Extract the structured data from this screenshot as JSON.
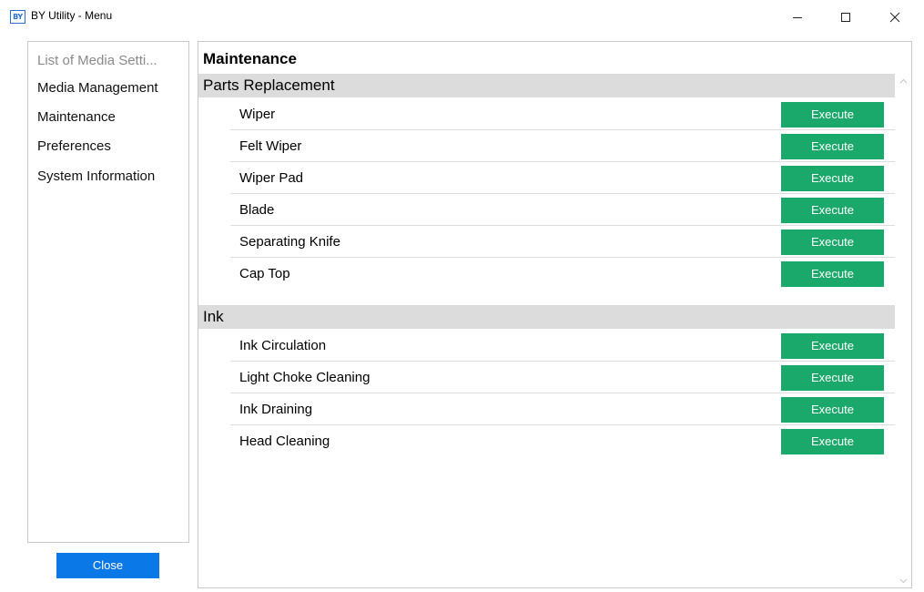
{
  "window": {
    "icon_text": "BY",
    "title": "BY Utility - Menu"
  },
  "sidebar": {
    "items": [
      {
        "label": "List of Media Setti..."
      },
      {
        "label": "Media Management"
      },
      {
        "label": "Maintenance"
      },
      {
        "label": "Preferences"
      },
      {
        "label": "System Information"
      }
    ],
    "close_label": "Close"
  },
  "main": {
    "title": "Maintenance",
    "sections": [
      {
        "title": "Parts Replacement",
        "rows": [
          {
            "label": "Wiper",
            "button": "Execute"
          },
          {
            "label": "Felt Wiper",
            "button": "Execute"
          },
          {
            "label": "Wiper Pad",
            "button": "Execute"
          },
          {
            "label": "Blade",
            "button": "Execute"
          },
          {
            "label": "Separating Knife",
            "button": "Execute"
          },
          {
            "label": "Cap Top",
            "button": "Execute"
          }
        ]
      },
      {
        "title": "Ink",
        "rows": [
          {
            "label": "Ink Circulation",
            "button": "Execute"
          },
          {
            "label": "Light Choke Cleaning",
            "button": "Execute"
          },
          {
            "label": "Ink Draining",
            "button": "Execute"
          },
          {
            "label": "Head Cleaning",
            "button": "Execute"
          }
        ]
      }
    ]
  },
  "colors": {
    "execute_button": "#1aa96a",
    "close_button": "#0a78e6",
    "section_header": "#dcdcdc"
  }
}
